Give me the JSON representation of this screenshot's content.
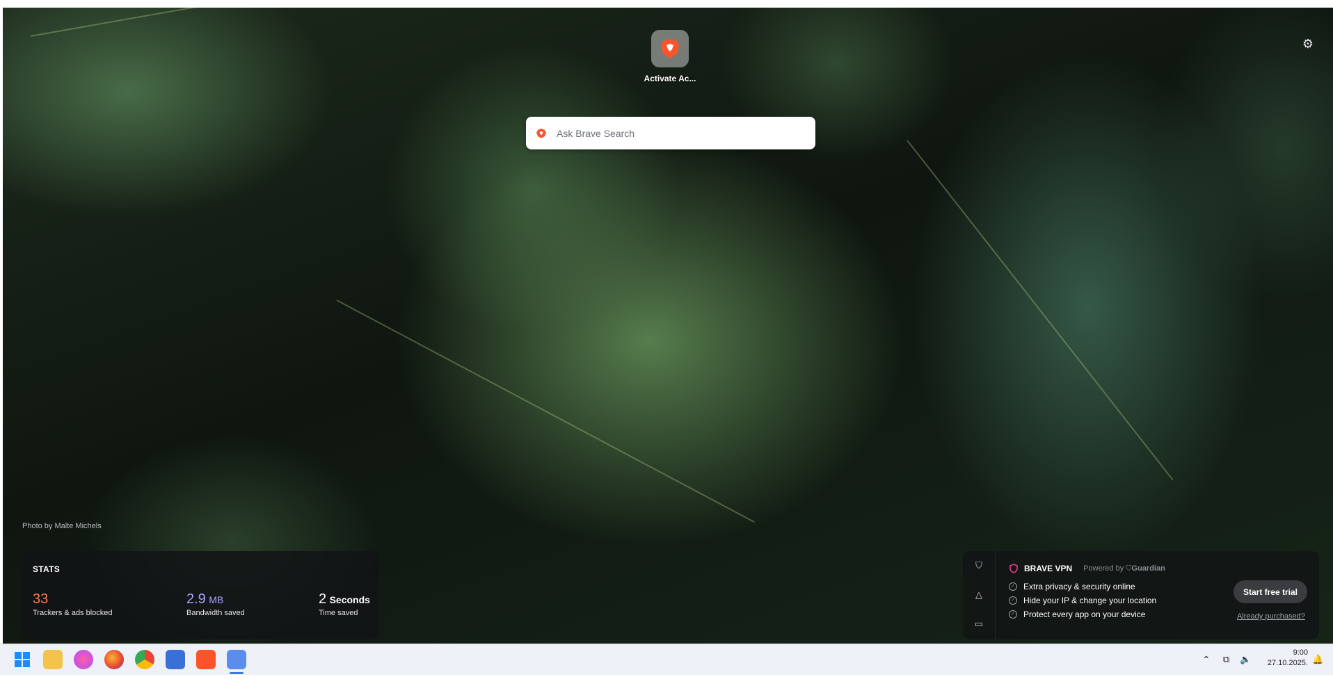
{
  "top_site": {
    "label": "Activate Ac..."
  },
  "search": {
    "placeholder": "Ask Brave Search"
  },
  "photo_credit": "Photo by Malte Michels",
  "stats": {
    "title": "STATS",
    "trackers": {
      "value": "33",
      "label": "Trackers & ads blocked",
      "color": "#ff7a59"
    },
    "bandwidth": {
      "value": "2.9",
      "unit": "MB",
      "label": "Bandwidth saved",
      "color": "#a8a4ff"
    },
    "time": {
      "value": "2",
      "unit": "Seconds",
      "label": "Time saved"
    }
  },
  "vpn": {
    "brand": "BRAVE VPN",
    "powered_by": "Powered by",
    "partner": "Guardian",
    "features": [
      "Extra privacy & security online",
      "Hide your IP & change your location",
      "Protect every app on your device"
    ],
    "cta": "Start free trial",
    "already": "Already purchased?"
  },
  "taskbar": {
    "time": "9:00",
    "date": "27.10.2025."
  }
}
